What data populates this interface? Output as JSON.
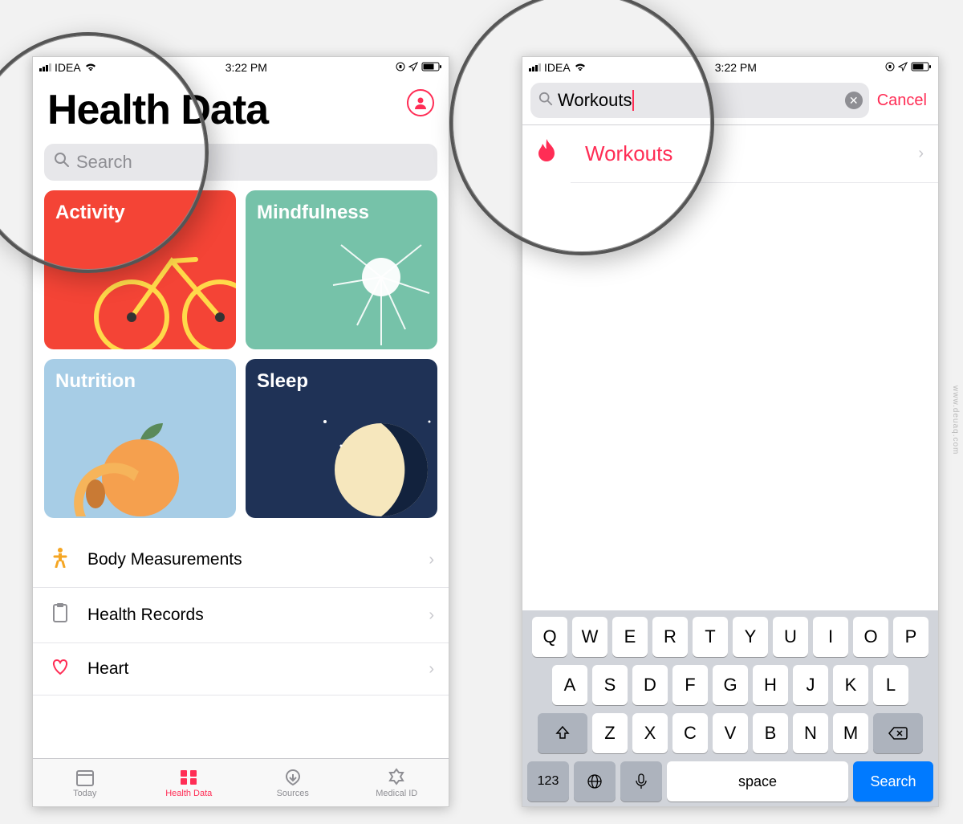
{
  "status": {
    "carrier": "IDEA",
    "time": "3:22 PM"
  },
  "left": {
    "page_title": "Health Data",
    "search_placeholder": "Search",
    "tiles": {
      "activity": "Activity",
      "mindfulness": "Mindfulness",
      "nutrition": "Nutrition",
      "sleep": "Sleep"
    },
    "rows": {
      "body": "Body Measurements",
      "records": "Health Records",
      "heart": "Heart"
    },
    "tabs": {
      "today": "Today",
      "health_data": "Health Data",
      "sources": "Sources",
      "medical_id": "Medical ID"
    }
  },
  "right": {
    "search_value": "Workouts",
    "cancel": "Cancel",
    "result": "Workouts",
    "keyboard": {
      "row1": [
        "Q",
        "W",
        "E",
        "R",
        "T",
        "Y",
        "U",
        "I",
        "O",
        "P"
      ],
      "row2": [
        "A",
        "S",
        "D",
        "F",
        "G",
        "H",
        "J",
        "K",
        "L"
      ],
      "row3": [
        "Z",
        "X",
        "C",
        "V",
        "B",
        "N",
        "M"
      ],
      "num": "123",
      "space": "space",
      "search": "Search"
    }
  },
  "watermark": "www.deuaq.com"
}
